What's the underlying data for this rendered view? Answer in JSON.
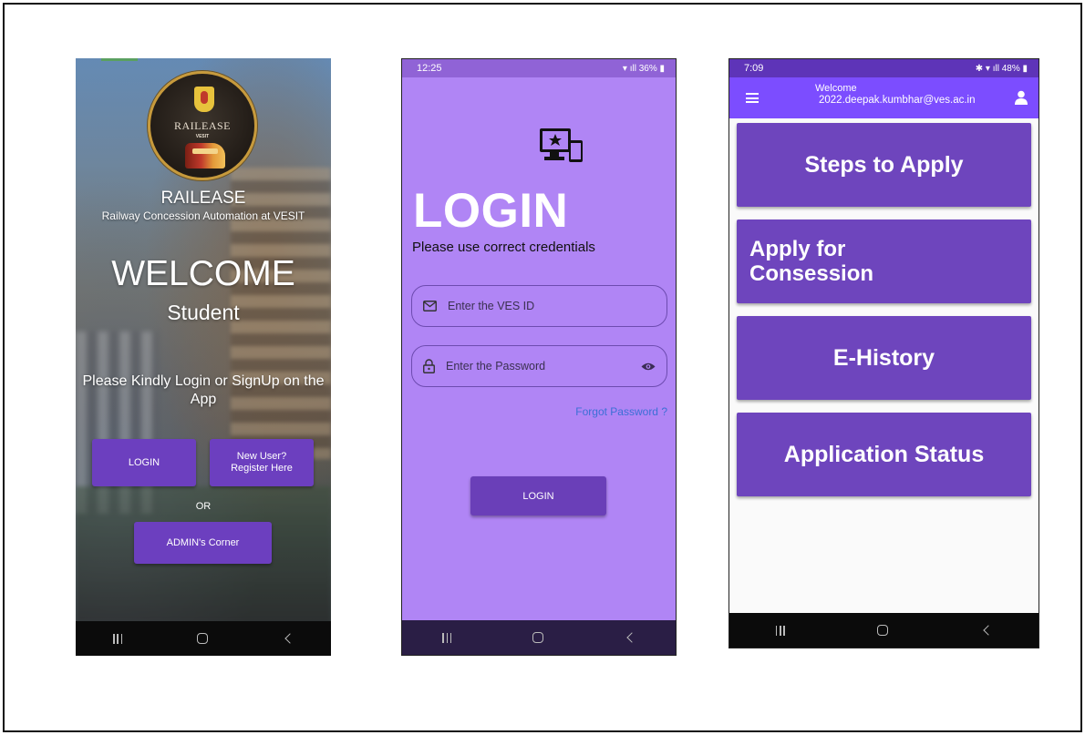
{
  "phone1": {
    "logo": {
      "title": "RAILEASE",
      "subtitle": "VESIT"
    },
    "app_name": "RAILEASE",
    "tagline": "Railway Concession Automation at VESIT",
    "welcome": "WELCOME",
    "role": "Student",
    "message": "Please Kindly Login or SignUp on the App",
    "login_button": "LOGIN",
    "register_line1": "New User?",
    "register_line2": "Register Here",
    "or_text": "OR",
    "admin_button": "ADMIN's Corner"
  },
  "phone2": {
    "status": {
      "time": "12:25",
      "right": "36%"
    },
    "title": "LOGIN",
    "subtitle": "Please use correct credentials",
    "email_placeholder": "Enter the VES ID",
    "password_placeholder": "Enter the Password",
    "forgot": "Forgot Password ?",
    "login_button": "LOGIN"
  },
  "phone3": {
    "status": {
      "time": "7:09",
      "right": "48%"
    },
    "appbar": {
      "welcome": "Welcome",
      "email": "2022.deepak.kumbhar@ves.ac.in"
    },
    "tiles": [
      "Steps to Apply",
      "Apply for Consession",
      "E-History",
      "Application Status"
    ]
  },
  "colors": {
    "primary": "#6e45bd",
    "appbar": "#7c4dff",
    "login_bg": "#b085f5",
    "link": "#3b6fd6"
  }
}
